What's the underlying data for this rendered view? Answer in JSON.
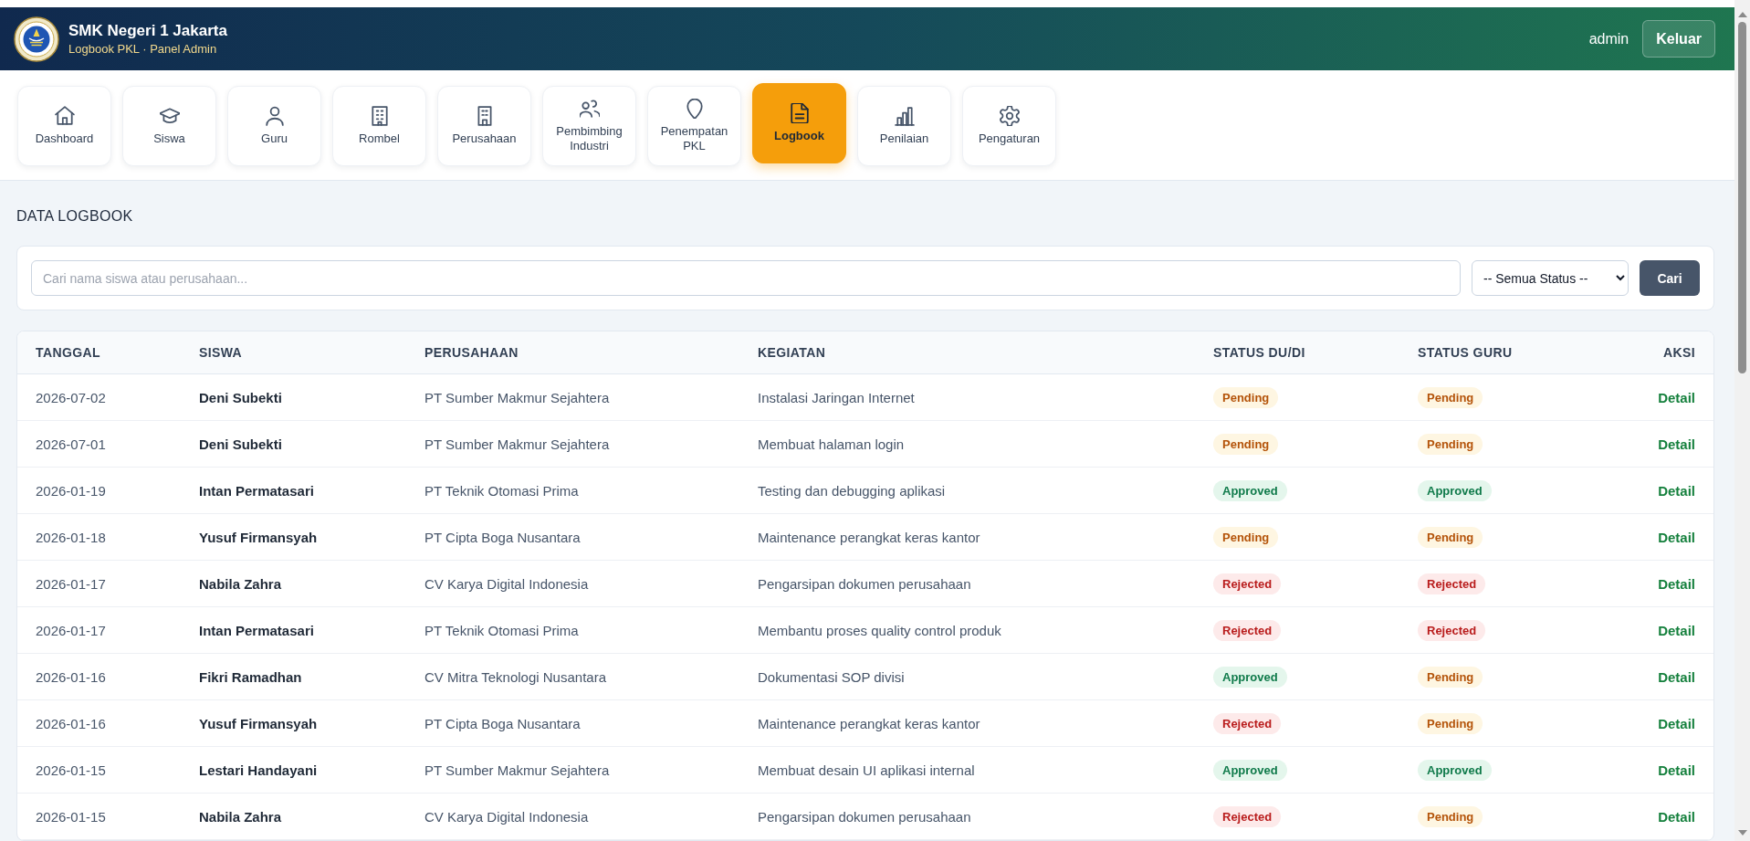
{
  "header": {
    "school_name": "SMK Negeri 1 Jakarta",
    "subtitle": "Logbook PKL · Panel Admin",
    "username": "admin",
    "logout_button": "Keluar"
  },
  "nav": [
    {
      "label": "Dashboard",
      "selected": false
    },
    {
      "label": "Siswa",
      "selected": false
    },
    {
      "label": "Guru",
      "selected": false
    },
    {
      "label": "Rombel",
      "selected": false
    },
    {
      "label": "Perusahaan",
      "selected": false
    },
    {
      "label": "Pembimbing Industri",
      "selected": false
    },
    {
      "label": "Penempatan PKL",
      "selected": false
    },
    {
      "label": "Logbook",
      "selected": true
    },
    {
      "label": "Penilaian",
      "selected": false
    },
    {
      "label": "Pengaturan",
      "selected": false
    }
  ],
  "page_title": "DATA LOGBOOK",
  "filters": {
    "search": {
      "placeholder": "Cari nama siswa atau perusahaan..."
    },
    "status_select": {
      "value": "-- Semua Status --"
    },
    "search_button": "Cari"
  },
  "table": {
    "columns": [
      "TANGGAL",
      "SISWA",
      "PERUSAHAAN",
      "KEGIATAN",
      "STATUS DU/DI",
      "STATUS GURU",
      "AKSI"
    ],
    "rows": [
      {
        "date": "2026-07-02",
        "student": "Deni Subekti",
        "company": "PT Sumber Makmur Sejahtera",
        "activity": "Instalasi Jaringan Internet",
        "status_dudi": {
          "label": "Pending",
          "kind": "pending"
        },
        "status_guru": {
          "label": "Pending",
          "kind": "pending"
        },
        "action": "Detail"
      },
      {
        "date": "2026-07-01",
        "student": "Deni Subekti",
        "company": "PT Sumber Makmur Sejahtera",
        "activity": "Membuat halaman login",
        "status_dudi": {
          "label": "Pending",
          "kind": "pending"
        },
        "status_guru": {
          "label": "Pending",
          "kind": "pending"
        },
        "action": "Detail"
      },
      {
        "date": "2026-01-19",
        "student": "Intan Permatasari",
        "company": "PT Teknik Otomasi Prima",
        "activity": "Testing dan debugging aplikasi",
        "status_dudi": {
          "label": "Approved",
          "kind": "approved"
        },
        "status_guru": {
          "label": "Approved",
          "kind": "approved"
        },
        "action": "Detail"
      },
      {
        "date": "2026-01-18",
        "student": "Yusuf Firmansyah",
        "company": "PT Cipta Boga Nusantara",
        "activity": "Maintenance perangkat keras kantor",
        "status_dudi": {
          "label": "Pending",
          "kind": "pending"
        },
        "status_guru": {
          "label": "Pending",
          "kind": "pending"
        },
        "action": "Detail"
      },
      {
        "date": "2026-01-17",
        "student": "Nabila Zahra",
        "company": "CV Karya Digital Indonesia",
        "activity": "Pengarsipan dokumen perusahaan",
        "status_dudi": {
          "label": "Rejected",
          "kind": "rejected"
        },
        "status_guru": {
          "label": "Rejected",
          "kind": "rejected"
        },
        "action": "Detail"
      },
      {
        "date": "2026-01-17",
        "student": "Intan Permatasari",
        "company": "PT Teknik Otomasi Prima",
        "activity": "Membantu proses quality control produk",
        "status_dudi": {
          "label": "Rejected",
          "kind": "rejected"
        },
        "status_guru": {
          "label": "Rejected",
          "kind": "rejected"
        },
        "action": "Detail"
      },
      {
        "date": "2026-01-16",
        "student": "Fikri Ramadhan",
        "company": "CV Mitra Teknologi Nusantara",
        "activity": "Dokumentasi SOP divisi",
        "status_dudi": {
          "label": "Approved",
          "kind": "approved"
        },
        "status_guru": {
          "label": "Pending",
          "kind": "pending"
        },
        "action": "Detail"
      },
      {
        "date": "2026-01-16",
        "student": "Yusuf Firmansyah",
        "company": "PT Cipta Boga Nusantara",
        "activity": "Maintenance perangkat keras kantor",
        "status_dudi": {
          "label": "Rejected",
          "kind": "rejected"
        },
        "status_guru": {
          "label": "Pending",
          "kind": "pending"
        },
        "action": "Detail"
      },
      {
        "date": "2026-01-15",
        "student": "Lestari Handayani",
        "company": "PT Sumber Makmur Sejahtera",
        "activity": "Membuat desain UI aplikasi internal",
        "status_dudi": {
          "label": "Approved",
          "kind": "approved"
        },
        "status_guru": {
          "label": "Approved",
          "kind": "approved"
        },
        "action": "Detail"
      },
      {
        "date": "2026-01-15",
        "student": "Nabila Zahra",
        "company": "CV Karya Digital Indonesia",
        "activity": "Pengarsipan dokumen perusahaan",
        "status_dudi": {
          "label": "Rejected",
          "kind": "rejected"
        },
        "status_guru": {
          "label": "Pending",
          "kind": "pending"
        },
        "action": "Detail"
      }
    ]
  }
}
